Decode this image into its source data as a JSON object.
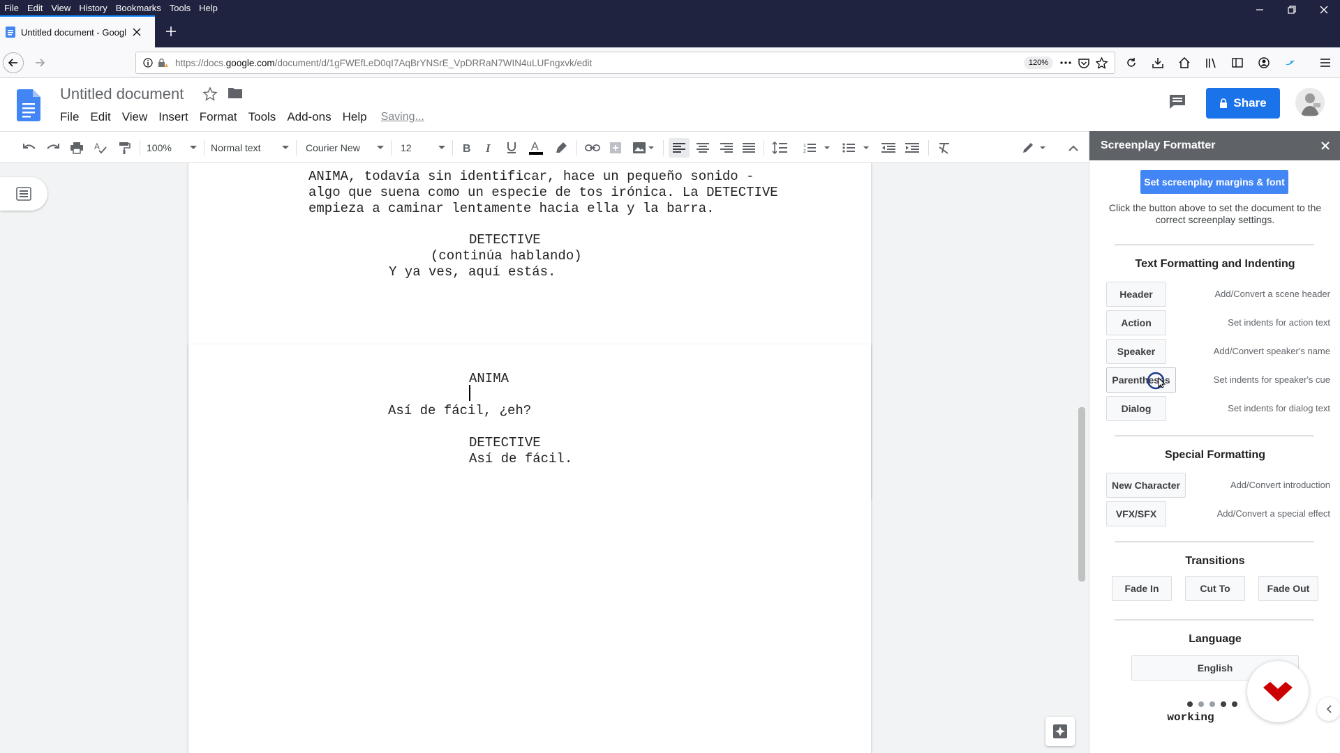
{
  "browser": {
    "menu": [
      "File",
      "Edit",
      "View",
      "History",
      "Bookmarks",
      "Tools",
      "Help"
    ],
    "tab_title": "Untitled document - Google Docs",
    "url_prefix": "https://docs.",
    "url_host": "google.com",
    "url_path": "/document/d/1gFWEfLeD0qI7AqBrYNSrE_VpDRRaN7WIN4uLUFngxvk/edit",
    "zoom": "120%"
  },
  "docs": {
    "title": "Untitled document",
    "menu": [
      "File",
      "Edit",
      "View",
      "Insert",
      "Format",
      "Tools",
      "Add-ons",
      "Help"
    ],
    "status": "Saving...",
    "share_label": "Share",
    "accent": "#1a73e8"
  },
  "toolbar": {
    "zoom": "100%",
    "style": "Normal text",
    "font": "Courier New",
    "size": "12"
  },
  "document": {
    "page1": [
      "ANIMA, todavía sin identificar, hace un pequeño sonido -",
      "algo que suena como un especie de tos irónica. La DETECTIVE",
      "empieza a caminar lentamente hacia ella y la barra.",
      "DETECTIVE",
      "(continúa hablando)",
      "Y ya ves, aquí estás."
    ],
    "page2": [
      "ANIMA",
      "Así de fácil, ¿eh?",
      "DETECTIVE",
      "Así de fácil."
    ]
  },
  "sidebar": {
    "title": "Screenplay Formatter",
    "set_margins_label": "Set screenplay margins & font",
    "description": "Click the button above to set the document to the correct screenplay settings.",
    "text_heading": "Text Formatting and Indenting",
    "text_buttons": [
      {
        "label": "Header",
        "desc": "Add/Convert a scene header"
      },
      {
        "label": "Action",
        "desc": "Set indents for action text"
      },
      {
        "label": "Speaker",
        "desc": "Add/Convert speaker's name"
      },
      {
        "label": "Parentheses",
        "desc": "Set indents for speaker's cue"
      },
      {
        "label": "Dialog",
        "desc": "Set indents for dialog text"
      }
    ],
    "special_heading": "Special Formatting",
    "special_buttons": [
      {
        "label": "New Character",
        "desc": "Add/Convert introduction"
      },
      {
        "label": "VFX/SFX",
        "desc": "Add/Convert a special effect"
      }
    ],
    "transitions_heading": "Transitions",
    "transitions": [
      "Fade In",
      "Cut To",
      "Fade Out"
    ],
    "language_heading": "Language",
    "language_value": "English",
    "working_text": "working"
  }
}
